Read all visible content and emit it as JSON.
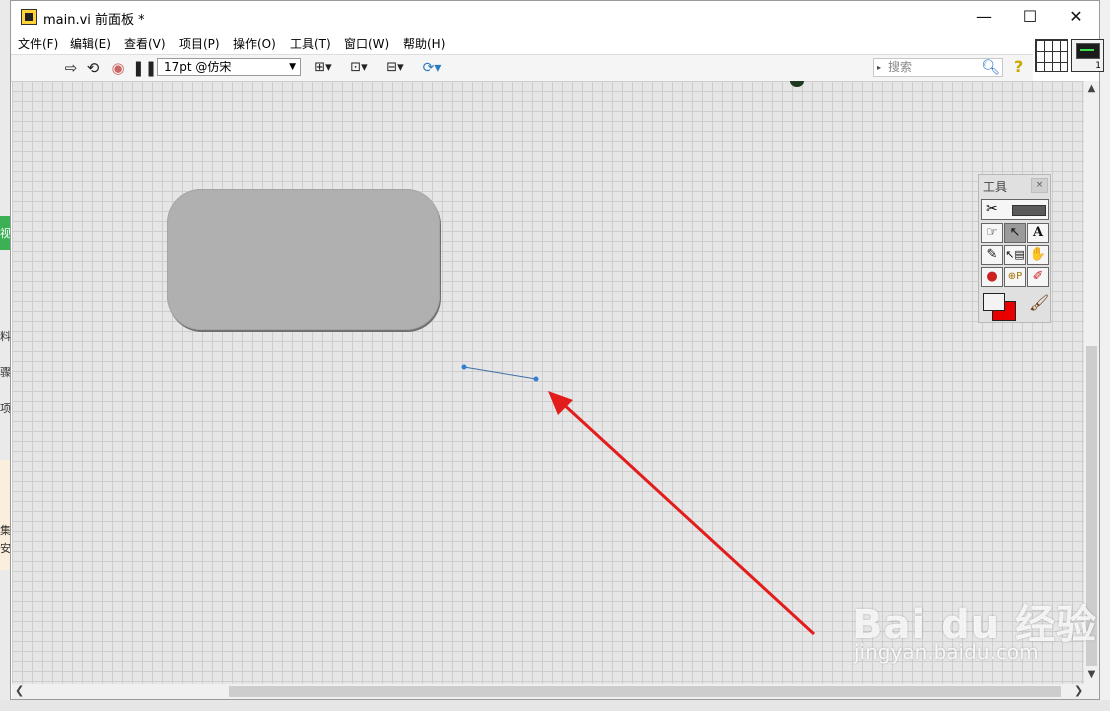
{
  "window": {
    "title": "main.vi 前面板 *"
  },
  "title_buttons": {
    "minimize": "—",
    "maximize": "☐",
    "close": "✕"
  },
  "menu": [
    "文件(F)",
    "编辑(E)",
    "查看(V)",
    "项目(P)",
    "操作(O)",
    "工具(T)",
    "窗口(W)",
    "帮助(H)"
  ],
  "toolbar": {
    "font": "17pt @仿宋",
    "search_placeholder": "搜索",
    "help": "?"
  },
  "tools_palette": {
    "title": "工具"
  },
  "background_text": [
    "料",
    "骤",
    "项",
    "视",
    "集",
    "安"
  ],
  "watermark": {
    "brand": "Bai du 经验",
    "url": "jingyan.baidu.com"
  },
  "colors": {
    "arrow": "#e31c1c",
    "wire": "#3d6ea8",
    "panel_grid": "#cdcdcd",
    "panel_bg": "#e6e6e6",
    "decoration_box": "#b0b0b0",
    "foreground_color": "#f3f3f3",
    "background_color": "#e80000"
  }
}
